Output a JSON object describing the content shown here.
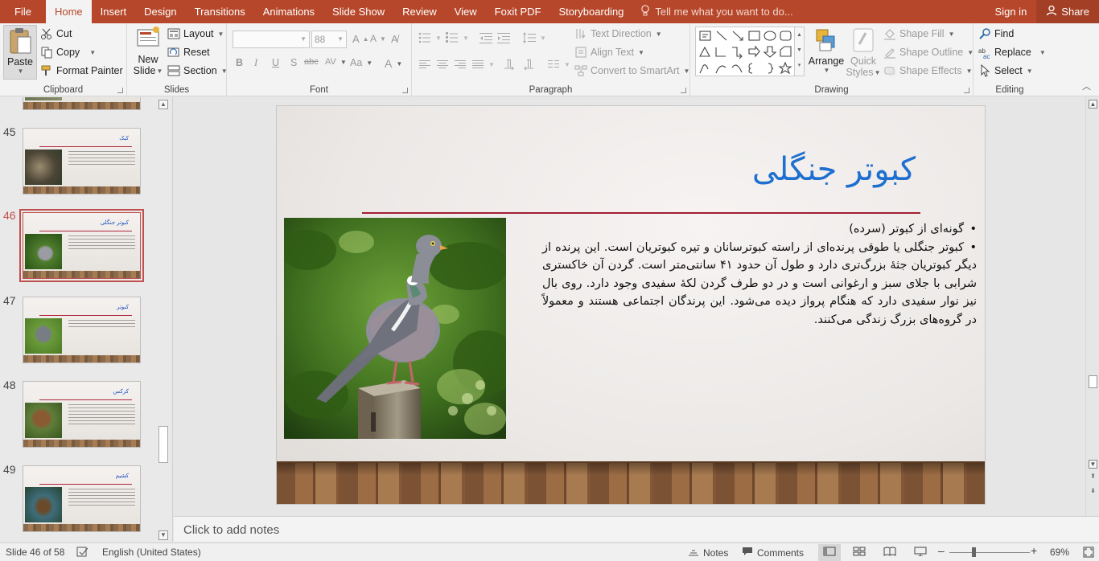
{
  "tabs": [
    "File",
    "Home",
    "Insert",
    "Design",
    "Transitions",
    "Animations",
    "Slide Show",
    "Review",
    "View",
    "Foxit PDF",
    "Storyboarding"
  ],
  "active_tab": "Home",
  "tell_me": "Tell me what you want to do...",
  "sign_in": "Sign in",
  "share": "Share",
  "ribbon": {
    "clipboard": {
      "label": "Clipboard",
      "paste": "Paste",
      "cut": "Cut",
      "copy": "Copy",
      "format_painter": "Format Painter"
    },
    "slides": {
      "label": "Slides",
      "new_slide_1": "New",
      "new_slide_2": "Slide",
      "layout": "Layout",
      "reset": "Reset",
      "section": "Section"
    },
    "font": {
      "label": "Font",
      "font_name": "",
      "font_size": "88",
      "bold": "B",
      "italic": "I",
      "underline": "U",
      "shadow": "S",
      "strike": "abc",
      "spacing": "AV",
      "case": "Aa",
      "color": "A"
    },
    "paragraph": {
      "label": "Paragraph",
      "text_direction": "Text Direction",
      "align_text": "Align Text",
      "convert_smartart": "Convert to SmartArt"
    },
    "drawing": {
      "label": "Drawing",
      "arrange": "Arrange",
      "quick_styles_1": "Quick",
      "quick_styles_2": "Styles",
      "shape_fill": "Shape Fill",
      "shape_outline": "Shape Outline",
      "shape_effects": "Shape Effects"
    },
    "editing": {
      "label": "Editing",
      "find": "Find",
      "replace": "Replace",
      "select": "Select"
    }
  },
  "thumbnails": [
    {
      "num": "45",
      "title": "کبک",
      "selected": false
    },
    {
      "num": "46",
      "title": "کبوتر جنگلی",
      "selected": true
    },
    {
      "num": "47",
      "title": "کبوتر",
      "selected": false
    },
    {
      "num": "48",
      "title": "کرکس",
      "selected": false
    },
    {
      "num": "49",
      "title": "کشیم",
      "selected": false
    }
  ],
  "slide": {
    "title": "کبوتر جنگلی",
    "bullet_1": "گونه‌ای از کبوتر (سرده)",
    "bullet_2": "کبوتر جنگلی  یا طوقی پرنده‌ای از راسته کبوترسانان و تیره کبوتریان است. این پرنده از دیگر کبوتریان جثهٔ بزرگ‌تری دارد و طول آن حدود ۴۱ سانتی‌متر است. گردن آن خاکستری شرابی با جلای سبز و ارغوانی است و در دو طرف گردن لکهٔ سفیدی وجود دارد. روی بال نیز نوار سفیدی دارد که هنگام پرواز دیده می‌شود. این پرندگان اجتماعی هستند و معمولاً در گروه‌های بزرگ زندگی می‌کنند."
  },
  "notes_placeholder": "Click to add notes",
  "status": {
    "slide_counter": "Slide 46 of 58",
    "language": "English (United States)",
    "notes": "Notes",
    "comments": "Comments",
    "zoom": "69%"
  },
  "colors": {
    "accent": "#b7472a",
    "title_blue": "#1e6fd0",
    "rule_red": "#a11f34"
  }
}
